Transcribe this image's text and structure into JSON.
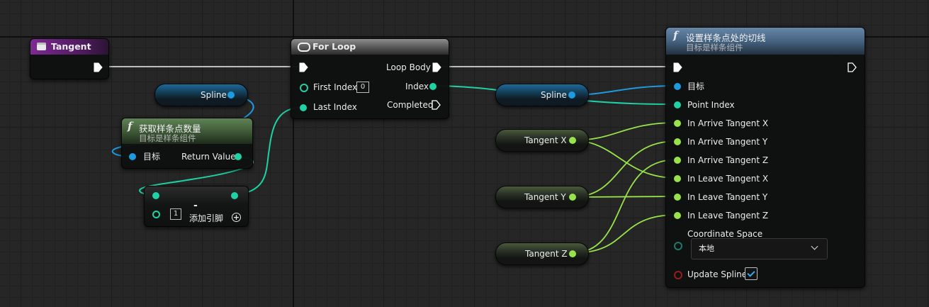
{
  "colors": {
    "exec": "#ffffff",
    "object_pin": "#1d9ae0",
    "integer_pin": "#1fd2a6",
    "float_pin": "#98e34b",
    "byte_pin": "#1a7a6b",
    "bool_pin": "#9a1c1c",
    "event_header": "#7d2a92",
    "pure_header": "#5b7b52",
    "function_header": "#587a99",
    "forloop_header": "#7a7a7a"
  },
  "tangent_node": {
    "title": "Tangent",
    "icon": "event-box-icon"
  },
  "spline_get_1": {
    "label": "Spline"
  },
  "get_count_node": {
    "title": "获取样条点数量",
    "subtitle": "目标是样条组件",
    "icon": "function-icon",
    "target_label": "目标",
    "return_label": "Return Value"
  },
  "subtract_node": {
    "op": "-",
    "b_value": "1",
    "add_pin_label": "添加引脚",
    "add_icon": "plus-circle-icon"
  },
  "for_loop_node": {
    "title": "For Loop",
    "icon": "loop-icon",
    "first_index_label": "First Index",
    "first_index_value": "0",
    "last_index_label": "Last Index",
    "loop_body_label": "Loop Body",
    "index_label": "Index",
    "completed_label": "Completed"
  },
  "spline_get_2": {
    "label": "Spline"
  },
  "tangent_x": {
    "label": "Tangent X"
  },
  "tangent_y": {
    "label": "Tangent Y"
  },
  "tangent_z": {
    "label": "Tangent Z"
  },
  "set_tangent_node": {
    "title": "设置样条点处的切线",
    "subtitle": "目标是样条组件",
    "icon": "function-icon",
    "pins": [
      "目标",
      "Point Index",
      "In Arrive Tangent X",
      "In Arrive Tangent Y",
      "In Arrive Tangent Z",
      "In Leave Tangent X",
      "In Leave Tangent Y",
      "In Leave Tangent Z"
    ],
    "coordinate_space_label": "Coordinate Space",
    "coordinate_space_value": "本地",
    "dropdown_icon": "chevron-down-icon",
    "update_spline_label": "Update Spline",
    "update_spline_checked": true,
    "check_icon": "checkmark-icon"
  }
}
